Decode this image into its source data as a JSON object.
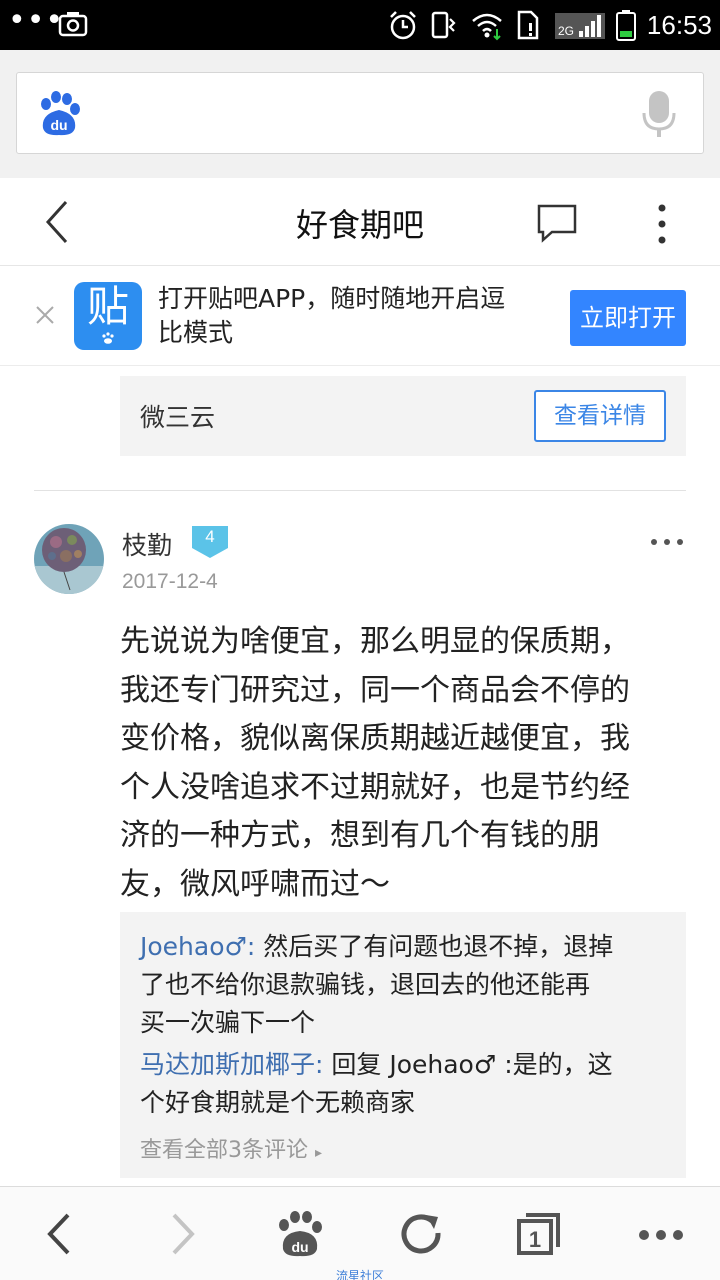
{
  "status_bar": {
    "time": "16:53",
    "network": "2G",
    "icons": [
      "more-dots-icon",
      "screenshot-icon",
      "alarm-icon",
      "vibrate-icon",
      "wifi-icon",
      "sim-alert-icon",
      "signal-icon",
      "battery-icon"
    ]
  },
  "search": {
    "logo": "du",
    "placeholder": ""
  },
  "header": {
    "title": "好食期吧"
  },
  "banner": {
    "app_glyph": "贴",
    "text_line1": "打开贴吧APP，随时随地开启逗",
    "text_line2": "比模式",
    "open_button": "立即打开"
  },
  "info_card": {
    "name": "微三云",
    "detail_button": "查看详情"
  },
  "post": {
    "username": "枝勤",
    "level": "4",
    "date": "2017-12-4",
    "content_lines": [
      "先说说为啥便宜，那么明显的保质期，",
      "我还专门研究过，同一个商品会不停的",
      "变价格，貌似离保质期越近越便宜，我",
      "个人没啥追求不过期就好，也是节约经",
      "济的一种方式，想到有几个有钱的朋",
      "友，微风呼啸而过～"
    ]
  },
  "comments": {
    "items": [
      {
        "author": "Joehao♂:",
        "line1": " 然后买了有问题也退不掉，退掉",
        "line2": "了也不给你退款骗钱，退回去的他还能再",
        "line3": "买一次骗下一个"
      },
      {
        "author": "马达加斯加椰子:",
        "line1": " 回复 Joehao♂ :是的，这",
        "line2": "个好食期就是个无赖商家"
      }
    ],
    "view_all": "查看全部3条评论"
  },
  "bottom_nav": {
    "caption": "流星社区",
    "tab_count": "1"
  },
  "colors": {
    "accent": "#3385ff",
    "link": "#3f6fb0",
    "badge": "#5bc3e8"
  }
}
